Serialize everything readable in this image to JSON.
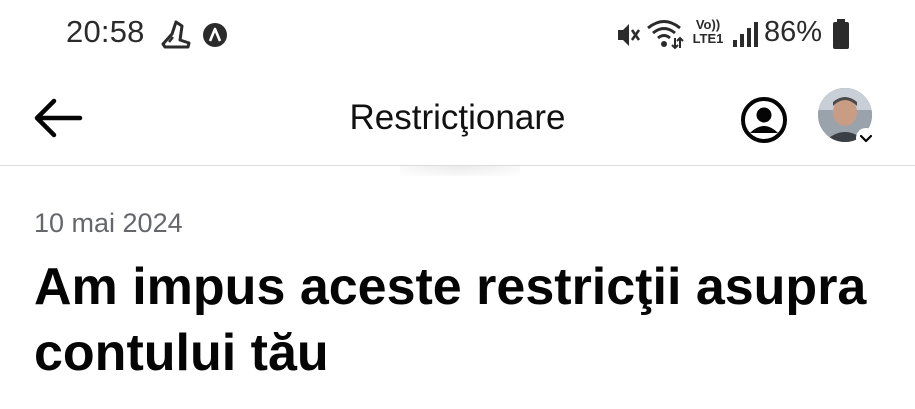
{
  "status_bar": {
    "time": "20:58",
    "left_icons": [
      "fitness-shoe-icon",
      "location-a-icon"
    ],
    "right_icons": [
      "vibrate-mute-icon",
      "wifi-icon",
      "volte-lte-icon",
      "signal-icon",
      "battery-icon"
    ],
    "volte_top": "Vo))",
    "volte_bottom": "LTE1",
    "battery_percent": "86%"
  },
  "header": {
    "title": "Restricţionare",
    "back_icon": "arrow-left-icon",
    "account_icon": "account-circle-icon"
  },
  "content": {
    "date": "10 mai 2024",
    "headline": "Am impus aceste restricţii asupra contului tău"
  },
  "colors": {
    "text_primary": "#050505",
    "text_secondary": "#65676b",
    "divider": "#dcdcdc",
    "background": "#ffffff"
  }
}
